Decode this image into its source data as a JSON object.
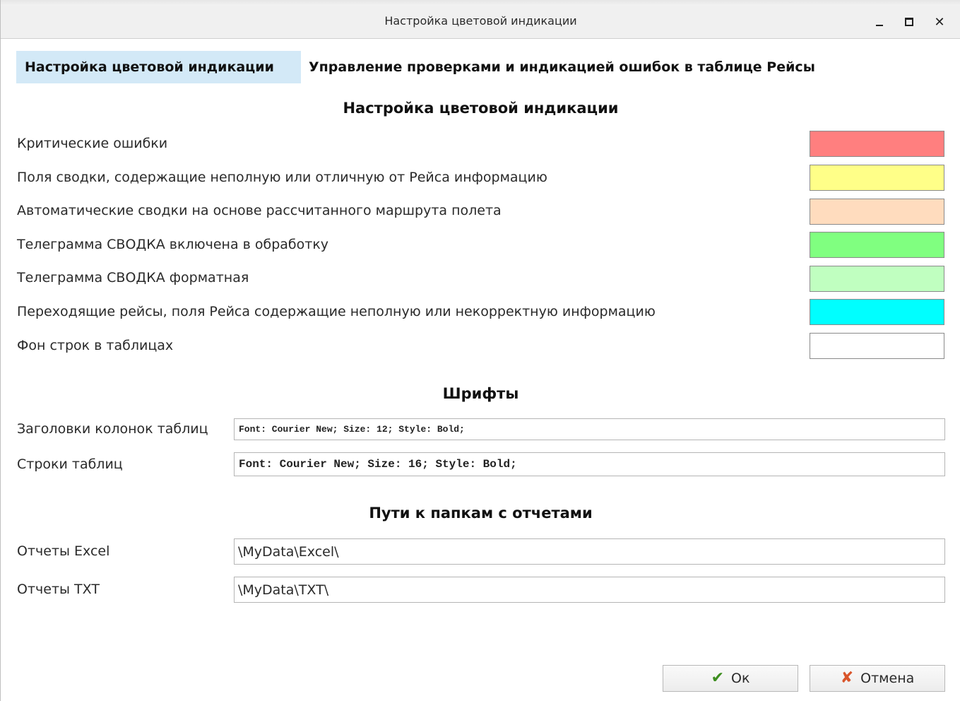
{
  "window": {
    "title": "Настройка цветовой индикации",
    "controls": {
      "minimize_icon": "minimize-icon",
      "maximize_icon": "maximize-icon",
      "close_icon": "close-icon",
      "close_glyph": "✕"
    }
  },
  "tabs": [
    {
      "label": "Настройка цветовой индикации",
      "active": true
    },
    {
      "label": "Управление проверками и индикацией ошибок в таблице Рейсы",
      "active": false
    }
  ],
  "colors_section": {
    "title": "Настройка цветовой индикации",
    "rows": [
      {
        "label": "Критические ошибки",
        "color": "#ff7f7f"
      },
      {
        "label": "Поля сводки, содержащие неполную или отличную от Рейса информацию",
        "color": "#ffff88"
      },
      {
        "label": "Автоматические сводки на основе рассчитанного маршрута полета",
        "color": "#ffdcbe"
      },
      {
        "label": "Телеграмма СВОДКА включена в обработку",
        "color": "#80ff80"
      },
      {
        "label": "Телеграмма СВОДКА форматная",
        "color": "#c0ffc0"
      },
      {
        "label": "Переходящие рейсы, поля Рейса содержащие неполную или некорректную информацию",
        "color": "#00ffff"
      },
      {
        "label": "Фон строк в таблицах",
        "color": "#ffffff"
      }
    ]
  },
  "fonts_section": {
    "title": "Шрифты",
    "header_font_label": "Заголовки колонок таблиц",
    "header_font_value": "Font: Courier New; Size: 12; Style: Bold;",
    "row_font_label": "Строки таблиц",
    "row_font_value": "Font: Courier New; Size: 16; Style: Bold;"
  },
  "paths_section": {
    "title": "Пути к папкам с отчетами",
    "excel_label": "Отчеты Excel",
    "excel_value": "\\MyData\\Excel\\",
    "txt_label": "Отчеты TXT",
    "txt_value": "\\MyData\\TXT\\"
  },
  "buttons": {
    "ok_label": "Ок",
    "ok_icon": "checkmark-icon",
    "ok_glyph": "✔",
    "cancel_label": "Отмена",
    "cancel_icon": "cross-icon",
    "cancel_glyph": "✘"
  }
}
